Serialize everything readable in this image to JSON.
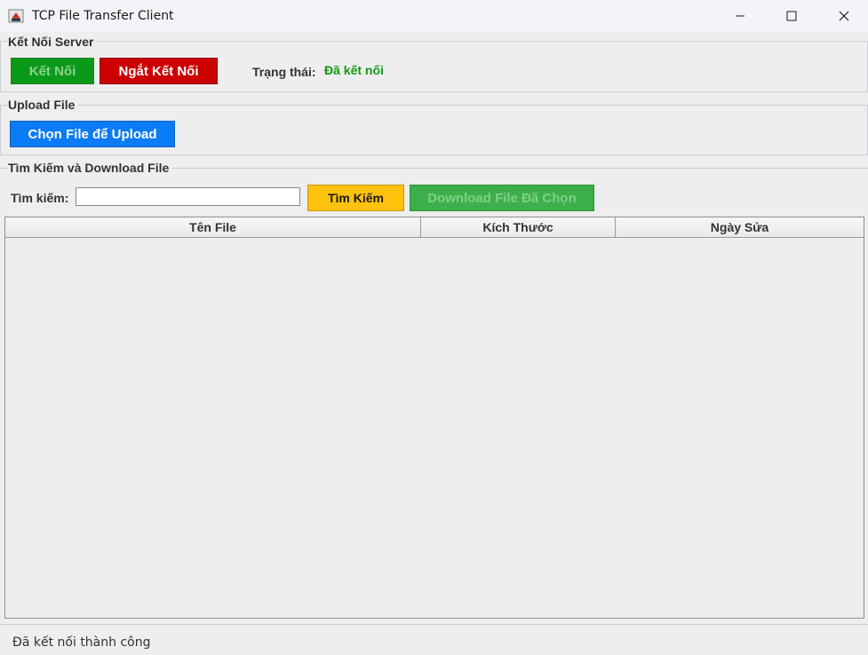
{
  "window": {
    "title": "TCP File Transfer Client"
  },
  "connection": {
    "section_title": "Kết Nối Server",
    "connect_label": "Kết Nối",
    "disconnect_label": "Ngắt Kết Nối",
    "status_label": "Trạng thái:",
    "status_value": "Đã kết nối"
  },
  "upload": {
    "section_title": "Upload File",
    "choose_label": "Chọn File để Upload"
  },
  "search": {
    "section_title": "Tìm Kiếm và Download File",
    "label": "Tìm kiếm:",
    "value": "",
    "search_label": "Tìm Kiếm",
    "download_label": "Download File Đã Chọn"
  },
  "table": {
    "columns": [
      "Tên File",
      "Kích Thước",
      "Ngày Sửa"
    ],
    "rows": []
  },
  "statusbar": {
    "text": "Đã kết nối thành công"
  },
  "colors": {
    "connect": "#0a9a1a",
    "disconnect": "#cc0000",
    "upload": "#0a7cf5",
    "search": "#ffc20e",
    "download": "#3cb04a",
    "status_ok": "#119911"
  },
  "icons": {
    "app": "java-coffee-icon",
    "minimize": "minimize-icon",
    "maximize": "maximize-icon",
    "close": "close-icon"
  }
}
